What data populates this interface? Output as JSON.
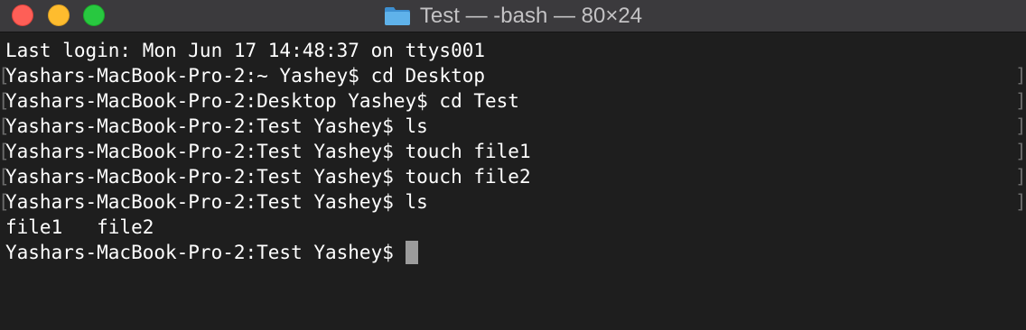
{
  "window": {
    "title": "Test — -bash — 80×24",
    "folder_icon": "folder-icon",
    "buttons": {
      "close": "close-button",
      "minimize": "minimize-button",
      "zoom": "zoom-button"
    }
  },
  "terminal": {
    "login_line": "Last login: Mon Jun 17 14:48:37 on ttys001",
    "lines": [
      {
        "text": "Yashars-MacBook-Pro-2:~ Yashey$ cd Desktop",
        "marked": true
      },
      {
        "text": "Yashars-MacBook-Pro-2:Desktop Yashey$ cd Test",
        "marked": true
      },
      {
        "text": "Yashars-MacBook-Pro-2:Test Yashey$ ls",
        "marked": true
      },
      {
        "text": "Yashars-MacBook-Pro-2:Test Yashey$ touch file1",
        "marked": true
      },
      {
        "text": "Yashars-MacBook-Pro-2:Test Yashey$ touch file2",
        "marked": true
      },
      {
        "text": "Yashars-MacBook-Pro-2:Test Yashey$ ls",
        "marked": true
      }
    ],
    "output_line": "file1   file2",
    "prompt": "Yashars-MacBook-Pro-2:Test Yashey$",
    "bracket_left": "[",
    "bracket_right": "]"
  },
  "colors": {
    "background": "#1e1e1e",
    "titlebar": "#3b3a3d",
    "text": "#ffffff",
    "cursor": "#9c9c9c",
    "close": "#fe5f57",
    "minimize": "#febc2e",
    "zoom": "#28c840",
    "folder": "#5fb2ea"
  }
}
